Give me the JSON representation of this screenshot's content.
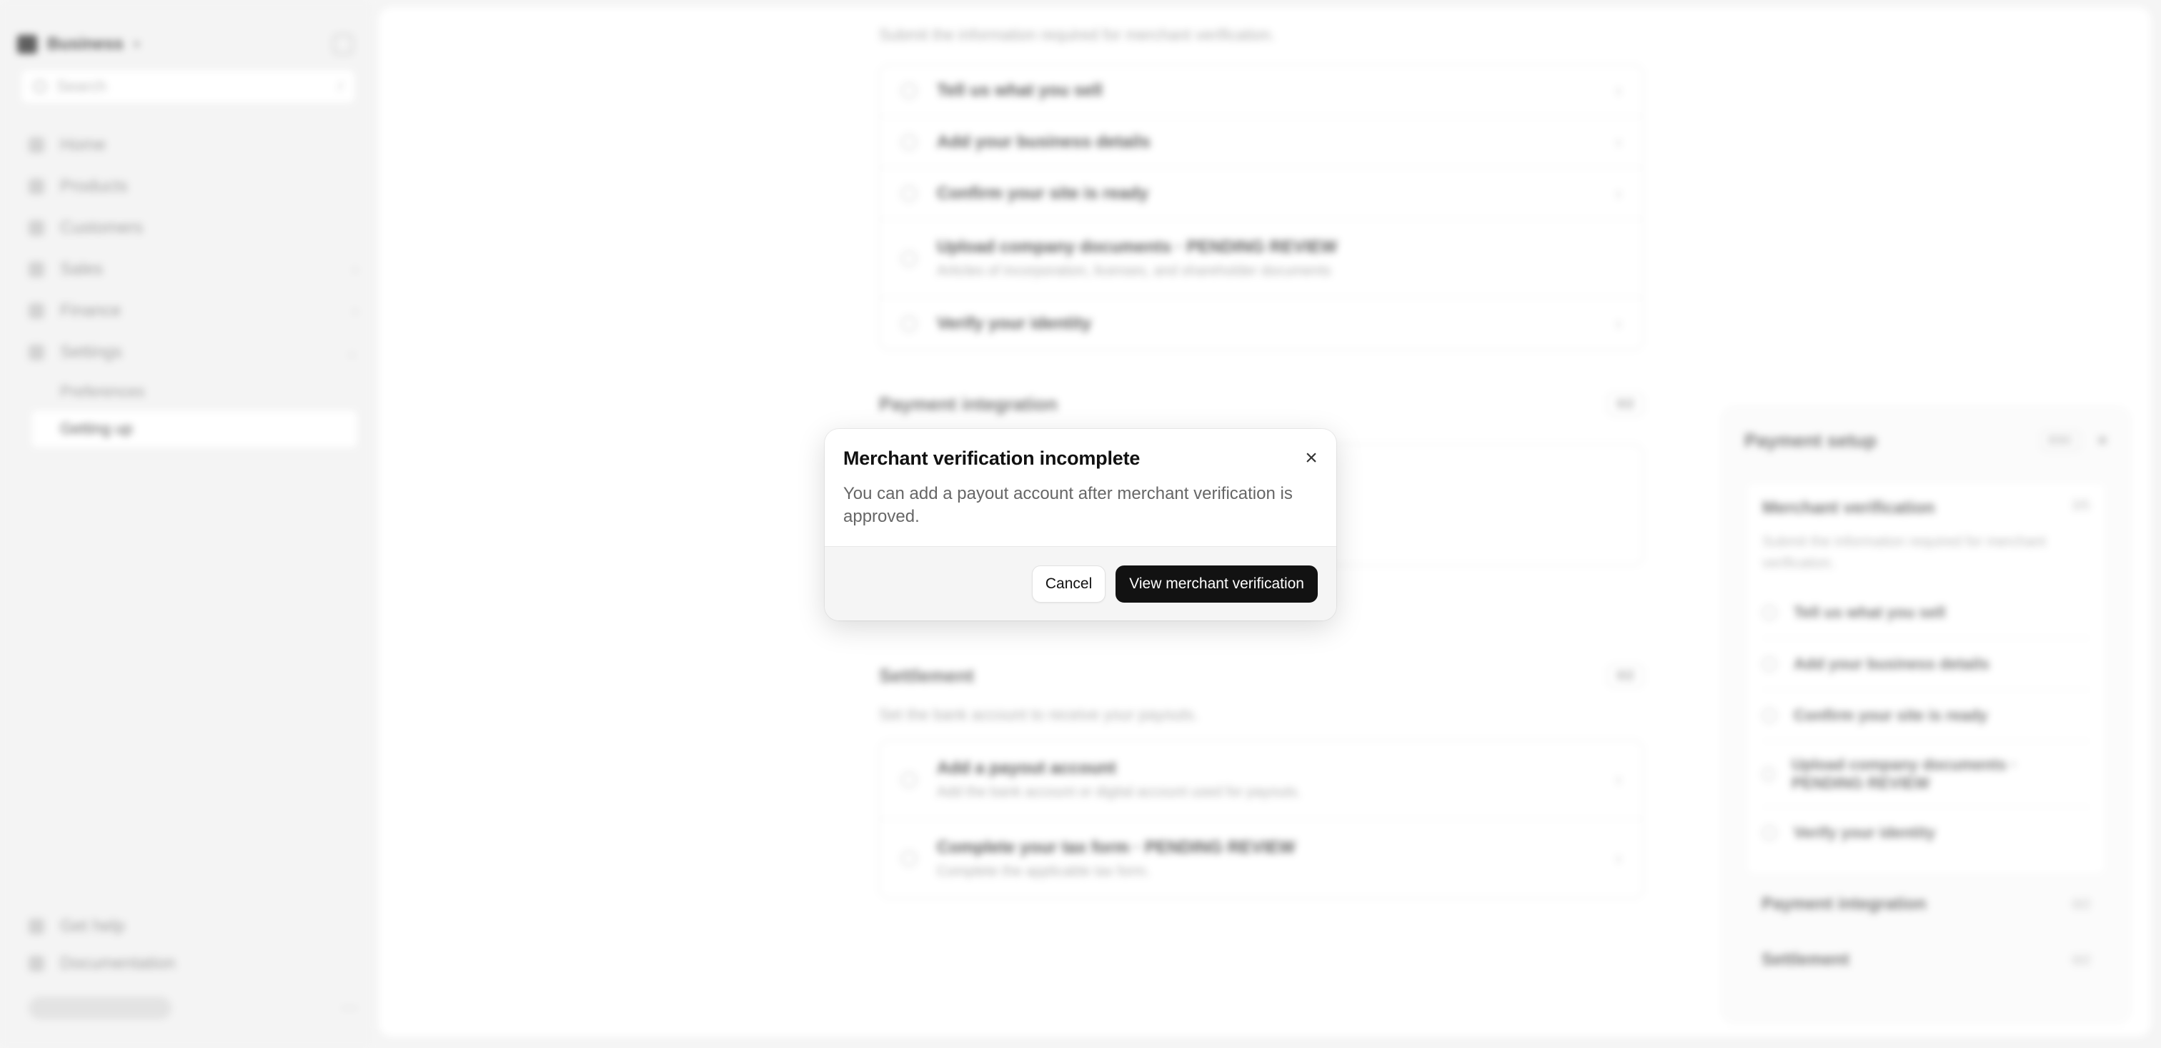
{
  "sidebar": {
    "brand": "Business",
    "search_placeholder": "Search",
    "search_shortcut": "/",
    "items": [
      {
        "label": "Home"
      },
      {
        "label": "Products"
      },
      {
        "label": "Customers"
      },
      {
        "label": "Sales"
      },
      {
        "label": "Finance"
      },
      {
        "label": "Settings"
      }
    ],
    "settings_children": [
      {
        "label": "Preferences"
      },
      {
        "label": "Getting up"
      }
    ],
    "bottom_items": [
      {
        "label": "Get help"
      },
      {
        "label": "Documentation"
      }
    ]
  },
  "main": {
    "intro_text": "Submit the information required for merchant verification.",
    "verification_rows": [
      {
        "label": "Tell us what you sell"
      },
      {
        "label": "Add your business details"
      },
      {
        "label": "Confirm your site is ready"
      },
      {
        "label": "Upload company documents · PENDING REVIEW",
        "sub": "Articles of incorporation, licenses, and shareholder documents"
      },
      {
        "label": "Verify your identity"
      }
    ],
    "payment_integration": {
      "title": "Payment integration",
      "badge": "0/2"
    },
    "settlement": {
      "title": "Settlement",
      "badge": "0/2",
      "intro": "Set the bank account to receive your payouts.",
      "rows": [
        {
          "label": "Add a payout account",
          "sub": "Add the bank account or digital account used for payouts."
        },
        {
          "label": "Complete your tax form · PENDING REVIEW",
          "sub": "Complete the applicable tax form."
        }
      ]
    }
  },
  "panel": {
    "title": "Payment setup",
    "esc": "ESC",
    "merchant": {
      "title": "Merchant verification",
      "badge": "3/5",
      "text": "Submit the information required for merchant verification.",
      "rows": [
        {
          "label": "Tell us what you sell"
        },
        {
          "label": "Add your business details"
        },
        {
          "label": "Confirm your site is ready"
        },
        {
          "label": "Upload company documents · PENDING REVIEW"
        },
        {
          "label": "Verify your identity"
        }
      ]
    },
    "payment_integration": {
      "title": "Payment integration",
      "badge": "0/2"
    },
    "settlement": {
      "title": "Settlement",
      "badge": "0/2"
    }
  },
  "modal": {
    "title": "Merchant verification incomplete",
    "message": "You can add a payout account after merchant verification is approved.",
    "close_icon": "×",
    "cancel_label": "Cancel",
    "primary_label": "View merchant verification"
  },
  "colors": {
    "primary_button": "#121212",
    "footer_bg": "#f5f5f5"
  }
}
